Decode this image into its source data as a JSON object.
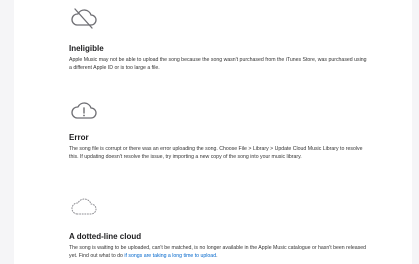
{
  "sections": {
    "ineligible": {
      "icon": "cloud-slash-icon",
      "heading": "Ineligible",
      "body": "Apple Music may not be able to upload the song because the song wasn't purchased from the iTunes Store, was purchased using a different Apple ID or is too large a file."
    },
    "error": {
      "icon": "cloud-exclamation-icon",
      "heading": "Error",
      "body": "The song file is corrupt or there was an error uploading the song. Choose File > Library > Update Cloud Music Library to resolve this. If updating doesn't resolve the issue, try importing a new copy of the song into your music library."
    },
    "dotted": {
      "icon": "dotted-cloud-icon",
      "heading": "A dotted-line cloud",
      "body_prefix": "The song is waiting to be uploaded, can't be matched, is no longer available in the Apple Music catalogue or hasn't been released yet. Find out what to do ",
      "link_text": "if songs are taking a long time to upload",
      "body_suffix": "."
    }
  },
  "colors": {
    "link": "#0066cc",
    "icon_stroke": "#6e6e73"
  }
}
